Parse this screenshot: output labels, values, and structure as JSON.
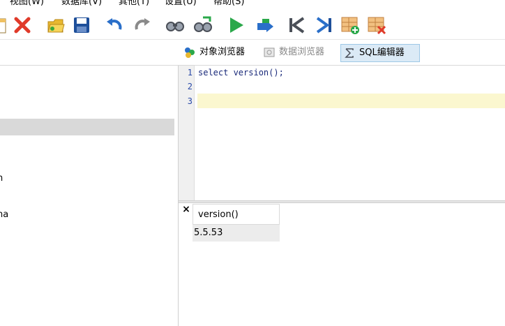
{
  "menubar": {
    "items": [
      "视图(W)",
      "数据库(V)",
      "其他(T)",
      "设置(U)",
      "帮助(S)"
    ]
  },
  "toolbar": {
    "buttons": [
      "new-doc-icon",
      "delete-icon",
      "open-folder-icon",
      "save-icon",
      "undo-icon",
      "redo-icon",
      "find-icon",
      "replace-icon",
      "run-icon",
      "step-icon",
      "first-icon",
      "last-icon",
      "add-row-icon",
      "delete-row-icon"
    ],
    "colors": {
      "red": "#e03a2a",
      "green": "#2aa84a",
      "blue": "#2a6fc9",
      "navy": "#1e4f9a"
    }
  },
  "view_tabs": [
    {
      "label": "对象浏览器",
      "icon": "object-browser-icon",
      "state": "normal"
    },
    {
      "label": "数据浏览器",
      "icon": "data-browser-icon",
      "state": "disabled"
    },
    {
      "label": "SQL编辑器",
      "icon": "sql-editor-icon",
      "state": "active"
    }
  ],
  "left_tree": {
    "items": [
      {
        "text": "n"
      },
      {
        "text": "na"
      }
    ]
  },
  "editor": {
    "line_numbers": [
      "1",
      "2",
      "3"
    ],
    "lines": [
      "select version();",
      "",
      ""
    ],
    "current_line_color": "#fbf7cf"
  },
  "results": {
    "close_label": "×",
    "columns": [
      "version()"
    ],
    "rows": [
      [
        "5.5.53"
      ]
    ]
  }
}
